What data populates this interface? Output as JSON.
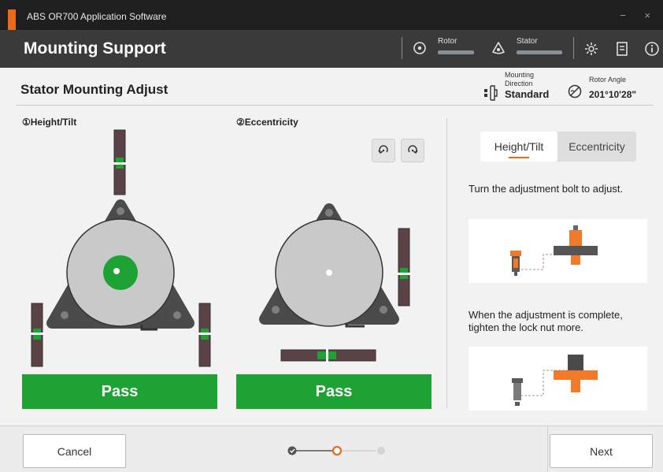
{
  "window": {
    "app_title": "ABS OR700 Application Software",
    "controls": "− ×"
  },
  "header": {
    "page_title": "Mounting Support",
    "rotor_label": "Rotor",
    "stator_label": "Stator"
  },
  "section": {
    "title": "Stator Mounting Adjust",
    "mounting_direction_label_1": "Mounting",
    "mounting_direction_label_2": "Direction",
    "mounting_direction_value": "Standard",
    "rotor_angle_label": "Rotor Angle",
    "rotor_angle_value": "201°10'28\""
  },
  "panels": {
    "height_tilt_label": "①Height/Tilt",
    "eccentricity_label": "②Eccentricity",
    "height_tilt_result": "Pass",
    "eccentricity_result": "Pass"
  },
  "side": {
    "tab_height_tilt": "Height/Tilt",
    "tab_eccentricity": "Eccentricity",
    "instruction_1": "Turn the adjustment bolt to adjust.",
    "instruction_2": "When the adjustment is complete, tighten the lock nut more."
  },
  "footer": {
    "cancel_label": "Cancel",
    "next_label": "Next",
    "steps": [
      "done",
      "current",
      "pending"
    ]
  },
  "colors": {
    "accent": "#e86a1c",
    "pass": "#1fa234",
    "header_bg": "#3a3a3a",
    "titlebar_bg": "#1f1f1f"
  }
}
